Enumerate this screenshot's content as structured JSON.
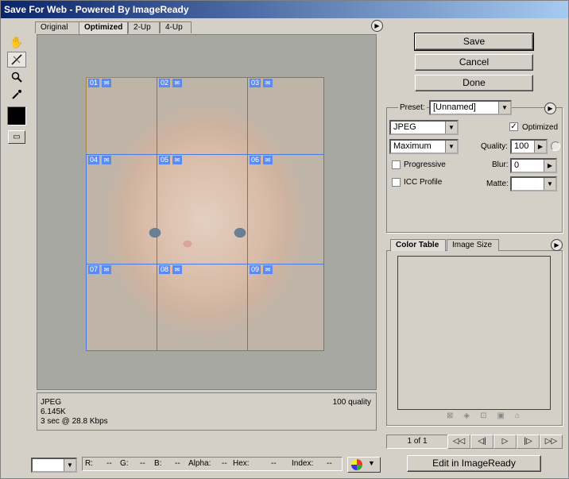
{
  "window": {
    "title": "Save For Web - Powered By ImageReady"
  },
  "toolbar": {
    "tools": [
      "hand-tool",
      "slice-select-tool",
      "zoom-tool",
      "eyedropper-tool"
    ],
    "color_swatch": "#000000"
  },
  "tabs": [
    {
      "label": "Original",
      "active": false
    },
    {
      "label": "Optimized",
      "active": true
    },
    {
      "label": "2-Up",
      "active": false
    },
    {
      "label": "4-Up",
      "active": false
    }
  ],
  "slices": [
    "01",
    "02",
    "03",
    "04",
    "05",
    "06",
    "07",
    "08",
    "09"
  ],
  "info": {
    "format": "JPEG",
    "size": "6.145K",
    "time": "3 sec @ 28.8 Kbps",
    "quality": "100 quality"
  },
  "buttons": {
    "save": "Save",
    "cancel": "Cancel",
    "done": "Done",
    "edit": "Edit in ImageReady"
  },
  "settings": {
    "preset_label": "Preset:",
    "preset_value": "[Unnamed]",
    "format": "JPEG",
    "quality_level": "Maximum",
    "optimized_label": "Optimized",
    "optimized": true,
    "quality_label": "Quality:",
    "quality_value": "100",
    "progressive_label": "Progressive",
    "blur_label": "Blur:",
    "blur_value": "0",
    "icc_label": "ICC Profile",
    "matte_label": "Matte:"
  },
  "panel_tabs": {
    "color_table": "Color Table",
    "image_size": "Image Size"
  },
  "pager": {
    "label": "1 of 1",
    "buttons": [
      "◁◁",
      "◁|",
      "▷",
      "|▷",
      "▷▷"
    ]
  },
  "statusbar": {
    "r_label": "R:",
    "r_value": "--",
    "g_label": "G:",
    "g_value": "--",
    "b_label": "B:",
    "b_value": "--",
    "alpha_label": "Alpha:",
    "alpha_value": "--",
    "hex_label": "Hex:",
    "hex_value": "--",
    "index_label": "Index:",
    "index_value": "--"
  },
  "colors": {
    "slice_blue": "#4a7ae0",
    "title_dark": "#0a246a",
    "title_light": "#a6caf0"
  }
}
